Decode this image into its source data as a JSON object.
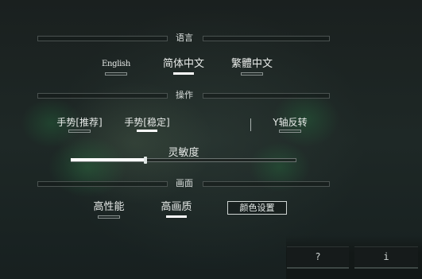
{
  "sections": {
    "language": "语言",
    "controls": "操作",
    "graphics": "画面"
  },
  "language_options": [
    {
      "label": "English",
      "selected": false
    },
    {
      "label": "简体中文",
      "selected": true
    },
    {
      "label": "繁體中文",
      "selected": false
    }
  ],
  "control_options": [
    {
      "label": "手势[推荐]",
      "selected": false
    },
    {
      "label": "手势[稳定]",
      "selected": true
    },
    {
      "label": "Y轴反转",
      "selected": false
    }
  ],
  "sensitivity": {
    "label": "灵敏度",
    "value": 0.33
  },
  "graphics_options": [
    {
      "label": "高性能",
      "selected": false
    },
    {
      "label": "高画质",
      "selected": true
    }
  ],
  "color_settings_label": "颜色设置",
  "corner_buttons": {
    "help": "?",
    "info": "i"
  },
  "colors": {
    "background": "#1c2422",
    "glow": "#2c8246",
    "selected_bar": "#ffffff"
  }
}
